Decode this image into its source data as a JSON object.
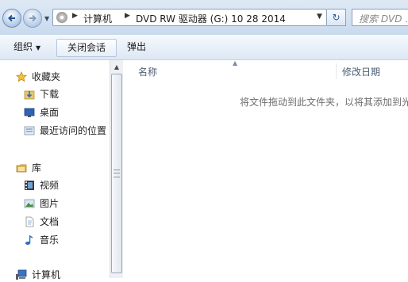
{
  "address_bar": {
    "breadcrumbs": [
      "计算机",
      "DVD RW 驱动器 (G:) 10 28 2014"
    ],
    "search_placeholder": "搜索 DVD ..."
  },
  "toolbar": {
    "organize_label": "组织",
    "close_session_label": "关闭会话",
    "eject_label": "弹出"
  },
  "nav": {
    "favorites": {
      "label": "收藏夹",
      "items": [
        "下载",
        "桌面",
        "最近访问的位置"
      ]
    },
    "libraries": {
      "label": "库",
      "items": [
        "视频",
        "图片",
        "文档",
        "音乐"
      ]
    },
    "computer": {
      "label": "计算机"
    }
  },
  "content": {
    "columns": [
      "名称",
      "修改日期"
    ],
    "empty_message": "将文件拖动到此文件夹，以将其添加到光"
  },
  "icons": {
    "back": "back-arrow-icon",
    "forward": "forward-arrow-icon",
    "drive": "dvd-drive-icon",
    "refresh": "refresh-icon",
    "favorites": "star-icon",
    "downloads": "download-folder-icon",
    "desktop": "desktop-icon",
    "recent": "recent-places-icon",
    "libraries": "library-icon",
    "videos": "video-icon",
    "pictures": "picture-icon",
    "documents": "document-icon",
    "music": "music-note-icon",
    "computer": "computer-icon"
  },
  "colors": {
    "accent": "#2a5aa0",
    "toolbar_top": "#f5f9fd",
    "toolbar_bottom": "#dde8f4",
    "header_text": "#4d5e75"
  }
}
